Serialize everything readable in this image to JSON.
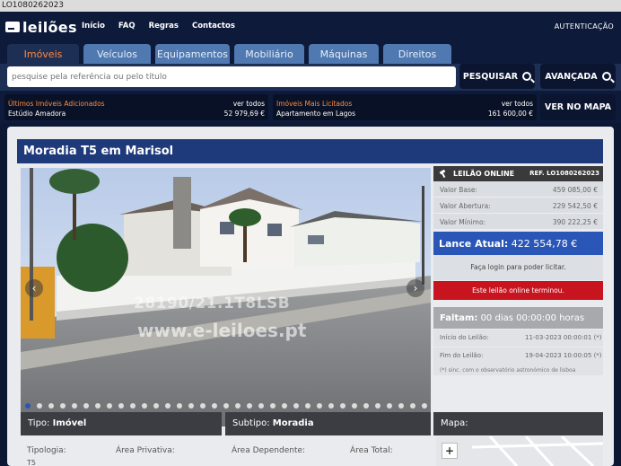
{
  "window": {
    "ref_label": "LO1080262023"
  },
  "header": {
    "logo_text": "leilões",
    "nav": [
      "Início",
      "FAQ",
      "Regras",
      "Contactos"
    ],
    "auth_label": "AUTENTICAÇÃO"
  },
  "tabs": [
    "Imóveis",
    "Veículos",
    "Equipamentos",
    "Mobiliário",
    "Máquinas",
    "Direitos"
  ],
  "search": {
    "placeholder": "pesquise pela referência ou pelo título",
    "search_button": "PESQUISAR",
    "advanced_button": "AVANÇADA",
    "map_button": "VER NO MAPA"
  },
  "stats": {
    "latest": {
      "label": "Últimos Imóveis Adicionados",
      "see_all": "ver todos",
      "item": "Estúdio Amadora",
      "price": "52 979,69 €"
    },
    "top": {
      "label": "Imóveis Mais Licitados",
      "see_all": "ver todos",
      "item": "Apartamento em Lagos",
      "price": "161 600,00 €"
    }
  },
  "listing": {
    "title": "Moradia T5 em Marisol",
    "watermark_ref": "28190/21.1T8LSB",
    "watermark_site": "www.e-leiloes.pt"
  },
  "auction": {
    "status": "LEILÃO ONLINE",
    "ref": "REF. LO1080262023",
    "rows": [
      {
        "label": "Valor Base:",
        "value": "459 085,00 €"
      },
      {
        "label": "Valor Abertura:",
        "value": "229 542,50 €"
      },
      {
        "label": "Valor Mínimo:",
        "value": "390 222,25 €"
      }
    ],
    "current_bid_label": "Lance Atual:",
    "current_bid_value": "422 554,78 €",
    "login_msg": "Faça login para poder licitar.",
    "ended_msg": "Este leilão online terminou.",
    "remaining_label": "Faltam:",
    "remaining_value": "00 dias 00:00:00 horas",
    "start_label": "Início do Leilão:",
    "start_value": "11-03-2023 00:00:01 (*)",
    "end_label": "Fim do Leilão:",
    "end_value": "19-04-2023 10:00:05 (*)",
    "note": "(*) sinc. com o observatório astronómico de lisboa"
  },
  "details": {
    "type_label": "Tipo:",
    "type_value": "Imóvel",
    "subtype_label": "Subtipo:",
    "subtype_value": "Moradia",
    "map_label": "Mapa:",
    "specs": [
      {
        "label": "Tipologia:",
        "value": "T5"
      },
      {
        "label": "Área Privativa:",
        "value": ""
      },
      {
        "label": "Área Dependente:",
        "value": ""
      },
      {
        "label": "Área Total:",
        "value": ""
      }
    ]
  },
  "colors": {
    "accent_orange": "#ff8a3d",
    "primary_blue": "#1e3a7a",
    "bid_blue": "#2a56b8",
    "ended_red": "#c8141e"
  }
}
